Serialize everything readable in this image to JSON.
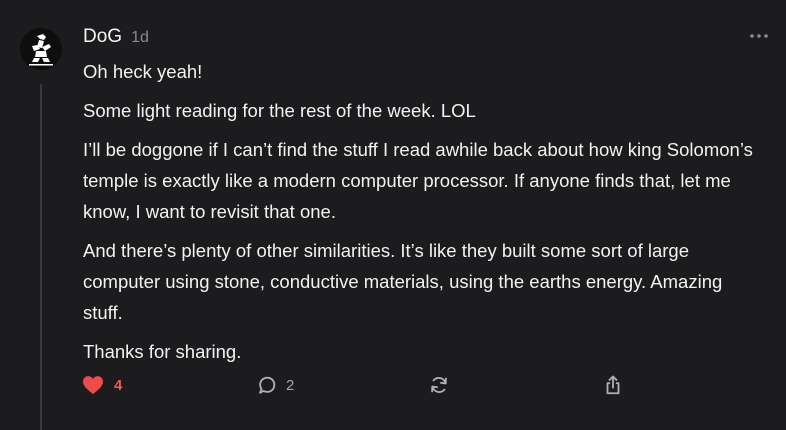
{
  "comment": {
    "author": "DoG",
    "time_ago": "1d",
    "avatar_icon": "dog-silhouette-avatar",
    "more_icon": "more-horizontal-icon",
    "paragraphs": [
      "Oh heck yeah!",
      "Some light reading for the rest of the week. LOL",
      "I’ll be doggone if I can’t find the stuff I read awhile back about how king Solomon’s temple is exactly like a modern computer processor. If anyone finds that, let me know, I want to revisit that one.",
      "And there’s plenty of other similarities. It’s like they built some sort of large computer using stone, conductive materials, using the earths energy. Amazing stuff.",
      "Thanks for sharing."
    ],
    "actions": {
      "like_count": "4",
      "like_color": "#ee5a5a",
      "reply_count": "2"
    }
  }
}
